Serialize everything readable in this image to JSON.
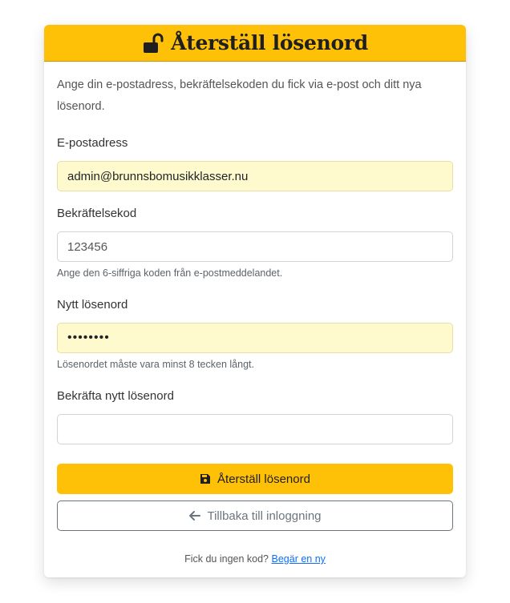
{
  "header": {
    "title": "Återställ lösenord",
    "icon": "unlock-icon",
    "background": "#ffc107"
  },
  "intro": "Ange din e-postadress, bekräftelsekoden du fick via e-post och ditt nya lösenord.",
  "form": {
    "email": {
      "label": "E-postadress",
      "value": "admin@brunnsbomusikklasser.nu"
    },
    "code": {
      "label": "Bekräftelsekod",
      "value": "123456",
      "help": "Ange den 6-siffriga koden från e-postmeddelandet."
    },
    "new_password": {
      "label": "Nytt lösenord",
      "value": "••••••••",
      "help": "Lösenordet måste vara minst 8 tecken långt."
    },
    "confirm_password": {
      "label": "Bekräfta nytt lösenord",
      "value": ""
    }
  },
  "buttons": {
    "submit_label": "Återställ lösenord",
    "submit_icon": "save-icon",
    "back_label": "Tillbaka till inloggning",
    "back_icon": "arrow-left-icon"
  },
  "footer": {
    "text": "Fick du ingen kod?",
    "link_label": "Begär en ny"
  },
  "colors": {
    "accent": "#ffc107",
    "autofill": "#fffacd",
    "link": "#0d6efd"
  }
}
